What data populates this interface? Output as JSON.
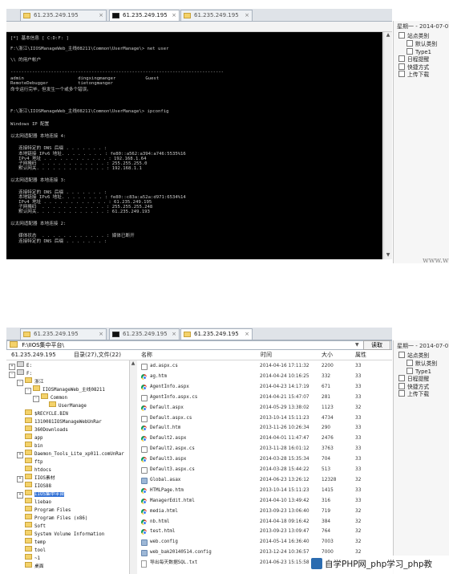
{
  "top_window": {
    "tabs": [
      {
        "label": "61.235.249.195",
        "type": "folder",
        "active": false
      },
      {
        "label": "61.235.249.195",
        "type": "cmd",
        "active": true
      },
      {
        "label": "61.235.249.195",
        "type": "folder",
        "active": false
      }
    ],
    "terminal_lines": [
      "[*] 基本信息 [ C:D:F: ]",
      "F:\\浙江\\IIOSManageWeb_主线08211\\Common\\UserManage\\> net user",
      "\\\\ 的用户帐户",
      "-------------------------------------------------------------------------------",
      "admin                    dingxingmanger           Guest",
      "RemoteDebugger           tietongmanger",
      "命令运行完毕，但发生一个或多个错误。",
      "",
      "F:\\浙江\\IIOSManageWeb_主线08211\\Common\\UserManage\\> ipconfig",
      "",
      "Windows IP 配置",
      "",
      "以太网适配器 本地连接 4:",
      "",
      "   连接特定的 DNS 后缀 . . . . . . . :",
      "   本地链接 IPv6 地址. . . . . . . . : fe80::a562:a394:a746:5535%16",
      "   IPv4 地址 . . . . . . . . . . . . : 192.168.1.64",
      "   子网掩码  . . . . . . . . . . . . : 255.255.255.0",
      "   默认网关. . . . . . . . . . . . . : 192.168.1.1",
      "",
      "以太网适配器 本地连接 3:",
      "",
      "   连接特定的 DNS 后缀 . . . . . . . :",
      "   本地链接 IPv6 地址. . . . . . . . : fe80::c83a:a52a:d971:6534%14",
      "   IPv4 地址 . . . . . . . . . . . . : 61.235.249.195",
      "   子网掩码  . . . . . . . . . . . . : 255.255.255.248",
      "   默认网关. . . . . . . . . . . . . : 61.235.249.193",
      "",
      "以太网适配器 本地连接 2:",
      "",
      "   媒体状态  . . . . . . . . . . . . : 媒体已断开",
      "   连接特定的 DNS 后缀 . . . . . . . :"
    ],
    "right_panel": {
      "date": "星期一 - 2014-07-07",
      "items": [
        {
          "label": "站点类别",
          "sub": false
        },
        {
          "label": "默认类别",
          "sub": true
        },
        {
          "label": "Type1",
          "sub": true
        },
        {
          "label": "日程提醒",
          "sub": false
        },
        {
          "label": "快捷方式",
          "sub": false
        },
        {
          "label": "上传下载",
          "sub": false
        }
      ]
    },
    "watermark_text": "www.w"
  },
  "bottom_window": {
    "tabs": [
      {
        "label": "61.235.249.195",
        "type": "folder",
        "active": false
      },
      {
        "label": "61.235.249.195",
        "type": "cmd",
        "active": false
      },
      {
        "label": "61.235.249.195",
        "type": "folder",
        "active": true
      }
    ],
    "path": "F:\\IIOS集中平台\\",
    "read_button": "读取",
    "host": "61.235.249.195",
    "summary": "目录(27),文件(22)",
    "columns": {
      "name": "名称",
      "time": "时间",
      "size": "大小",
      "attr": "属性"
    },
    "tree": [
      {
        "label": "E:",
        "level": 0,
        "exp": "+",
        "kind": "drive"
      },
      {
        "label": "F:",
        "level": 0,
        "exp": "-",
        "kind": "drive"
      },
      {
        "label": "浙江",
        "level": 1,
        "exp": "-",
        "kind": "folder"
      },
      {
        "label": "IIOSManageWeb_主线08211",
        "level": 2,
        "exp": "-",
        "kind": "folder"
      },
      {
        "label": "Common",
        "level": 3,
        "exp": "-",
        "kind": "folder"
      },
      {
        "label": "UserManage",
        "level": 4,
        "exp": "",
        "kind": "folder"
      },
      {
        "label": "$RECYCLE.BIN",
        "level": 1,
        "exp": "",
        "kind": "folder"
      },
      {
        "label": "1310081IOSManageWebUnRar",
        "level": 1,
        "exp": "",
        "kind": "folder"
      },
      {
        "label": "360Downloads",
        "level": 1,
        "exp": "",
        "kind": "folder"
      },
      {
        "label": "app",
        "level": 1,
        "exp": "",
        "kind": "folder"
      },
      {
        "label": "bin",
        "level": 1,
        "exp": "",
        "kind": "folder"
      },
      {
        "label": "Daemon_Tools_Lite_xp011.comUnRar",
        "level": 1,
        "exp": "+",
        "kind": "folder"
      },
      {
        "label": "ftp",
        "level": 1,
        "exp": "",
        "kind": "folder"
      },
      {
        "label": "htdocs",
        "level": 1,
        "exp": "",
        "kind": "folder"
      },
      {
        "label": "IIOS素材",
        "level": 1,
        "exp": "+",
        "kind": "folder"
      },
      {
        "label": "IIOS88",
        "level": 1,
        "exp": "",
        "kind": "folder"
      },
      {
        "label": "IIOS集中平台",
        "level": 1,
        "exp": "+",
        "kind": "folder",
        "selected": true
      },
      {
        "label": "liebao",
        "level": 1,
        "exp": "",
        "kind": "folder"
      },
      {
        "label": "Program Files",
        "level": 1,
        "exp": "",
        "kind": "folder"
      },
      {
        "label": "Program Files (x86)",
        "level": 1,
        "exp": "",
        "kind": "folder"
      },
      {
        "label": "Soft",
        "level": 1,
        "exp": "",
        "kind": "folder"
      },
      {
        "label": "System Volume Information",
        "level": 1,
        "exp": "",
        "kind": "folder"
      },
      {
        "label": "temp",
        "level": 1,
        "exp": "",
        "kind": "folder"
      },
      {
        "label": "tool",
        "level": 1,
        "exp": "",
        "kind": "folder"
      },
      {
        "label": "~1",
        "level": 1,
        "exp": "",
        "kind": "folder"
      },
      {
        "label": "桌面",
        "level": 1,
        "exp": "",
        "kind": "folder"
      }
    ],
    "files": [
      {
        "name": "ad.aspx.cs",
        "time": "2014-04-16 17:11:32",
        "size": "2200",
        "attr": "33",
        "icon": "cs"
      },
      {
        "name": "ag.htm",
        "time": "2014-04-24 10:16:25",
        "size": "332",
        "attr": "33",
        "icon": "chrome"
      },
      {
        "name": "AgentInfo.aspx",
        "time": "2014-04-23 14:17:19",
        "size": "671",
        "attr": "33",
        "icon": "chrome"
      },
      {
        "name": "AgentInfo.aspx.cs",
        "time": "2014-04-21 15:47:07",
        "size": "281",
        "attr": "33",
        "icon": "cs"
      },
      {
        "name": "Default.aspx",
        "time": "2014-05-29 13:38:02",
        "size": "1123",
        "attr": "32",
        "icon": "chrome"
      },
      {
        "name": "Default.aspx.cs",
        "time": "2013-10-14 15:11:23",
        "size": "4734",
        "attr": "33",
        "icon": "cs"
      },
      {
        "name": "Default.htm",
        "time": "2013-11-26 10:26:34",
        "size": "290",
        "attr": "33",
        "icon": "chrome"
      },
      {
        "name": "Default2.aspx",
        "time": "2014-04-01 11:47:47",
        "size": "2476",
        "attr": "33",
        "icon": "chrome"
      },
      {
        "name": "Default2.aspx.cs",
        "time": "2013-11-28 16:01:12",
        "size": "3763",
        "attr": "33",
        "icon": "cs"
      },
      {
        "name": "Default3.aspx",
        "time": "2014-03-28 15:35:34",
        "size": "704",
        "attr": "33",
        "icon": "chrome"
      },
      {
        "name": "Default3.aspx.cs",
        "time": "2014-03-28 15:44:22",
        "size": "513",
        "attr": "33",
        "icon": "cs"
      },
      {
        "name": "Global.asax",
        "time": "2014-06-23 13:26:12",
        "size": "12328",
        "attr": "32",
        "icon": "cfg"
      },
      {
        "name": "HTMLPage.htm",
        "time": "2013-10-14 15:11:23",
        "size": "1415",
        "attr": "33",
        "icon": "chrome"
      },
      {
        "name": "ManagerEdit.html",
        "time": "2014-04-10 13:49:42",
        "size": "316",
        "attr": "33",
        "icon": "chrome"
      },
      {
        "name": "media.html",
        "time": "2013-09-23 13:06:40",
        "size": "719",
        "attr": "32",
        "icon": "chrome"
      },
      {
        "name": "nb.html",
        "time": "2014-04-18 09:16:42",
        "size": "384",
        "attr": "32",
        "icon": "chrome"
      },
      {
        "name": "test.html",
        "time": "2013-09-23 13:09:47",
        "size": "764",
        "attr": "32",
        "icon": "chrome"
      },
      {
        "name": "web.config",
        "time": "2014-05-14 16:36:40",
        "size": "7003",
        "attr": "32",
        "icon": "cfg"
      },
      {
        "name": "web_bak20140514.config",
        "time": "2013-12-24 10:36:57",
        "size": "7000",
        "attr": "32",
        "icon": "cfg"
      },
      {
        "name": "导出每天数据SQL.txt",
        "time": "2014-06-23 15:15:58",
        "size": "",
        "attr": "",
        "icon": "file"
      }
    ],
    "right_panel": {
      "date": "星期一 - 2014-07-07",
      "items": [
        {
          "label": "站点类别",
          "sub": false
        },
        {
          "label": "默认类别",
          "sub": true
        },
        {
          "label": "Type1",
          "sub": true
        },
        {
          "label": "日程提醒",
          "sub": false
        },
        {
          "label": "快捷方式",
          "sub": false
        },
        {
          "label": "上传下载",
          "sub": false
        }
      ]
    },
    "watermark_text": "自学PHP网_php学习_php教"
  },
  "colors": {
    "terminal_bg": "#000000",
    "terminal_fg": "#c9c9c9",
    "selection": "#3875d7",
    "folder": "#f4d26a"
  }
}
